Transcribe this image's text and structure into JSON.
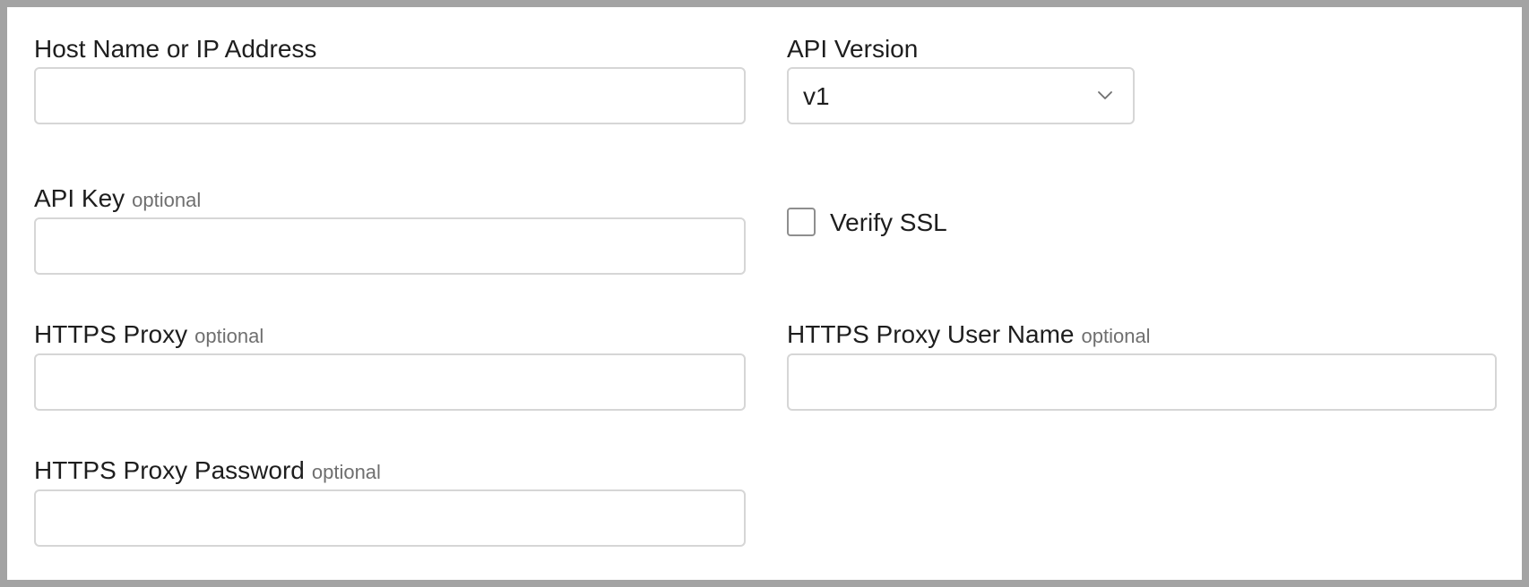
{
  "form": {
    "optional_tag": "optional",
    "host": {
      "label": "Host Name or IP Address",
      "value": ""
    },
    "api_version": {
      "label": "API Version",
      "selected": "v1",
      "icon": "chevron-down-icon"
    },
    "api_key": {
      "label": "API Key",
      "value": ""
    },
    "verify_ssl": {
      "label": "Verify SSL",
      "checked": false
    },
    "https_proxy": {
      "label": "HTTPS Proxy",
      "value": ""
    },
    "https_proxy_user": {
      "label": "HTTPS Proxy User Name",
      "value": ""
    },
    "https_proxy_password": {
      "label": "HTTPS Proxy Password",
      "value": ""
    }
  },
  "colors": {
    "background": "#a3a3a3",
    "panel": "#ffffff",
    "input_border": "#d6d6d6",
    "text": "#1e1e1e",
    "optional_text": "#6f6f6f"
  }
}
